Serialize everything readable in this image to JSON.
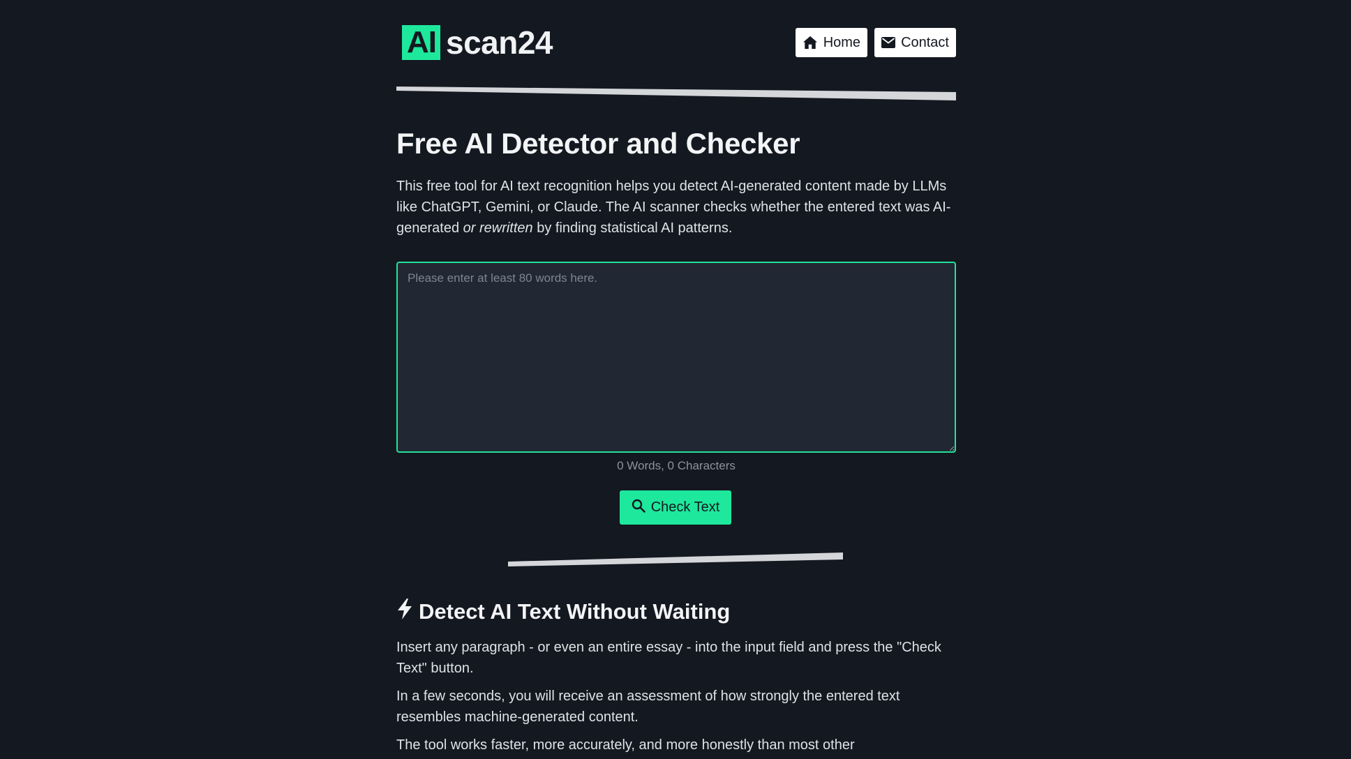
{
  "header": {
    "logo_badge": "AI",
    "logo_text": "scan24",
    "nav": {
      "home_label": "Home",
      "contact_label": "Contact"
    }
  },
  "hero": {
    "title": "Free AI Detector and Checker",
    "intro_part1": "This free tool for AI text recognition helps you detect AI-generated content made by LLMs like ChatGPT, Gemini, or Claude. The AI scanner checks whether the entered text was AI-generated ",
    "intro_emphasis": "or rewritten",
    "intro_part2": " by finding statistical AI patterns."
  },
  "input": {
    "value": "",
    "placeholder": "Please enter at least 80 words here.",
    "counter": "0 Words, 0 Characters"
  },
  "check_button_label": "Check Text",
  "section": {
    "title": "Detect AI Text Without Waiting",
    "paragraphs": [
      "Insert any paragraph - or even an entire essay - into the input field and press the \"Check Text\" button.",
      "In a few seconds, you will receive an assessment of how strongly the entered text resembles machine-generated content.",
      "The tool works faster, more accurately, and more honestly than most other"
    ]
  },
  "colors": {
    "background": "#141820",
    "accent": "#1ee89c",
    "input_background": "#222833",
    "divider": "#d4d6da"
  },
  "icons": {
    "home": "home-icon",
    "contact": "envelope-icon",
    "check": "search-icon",
    "section": "bolt-icon"
  }
}
